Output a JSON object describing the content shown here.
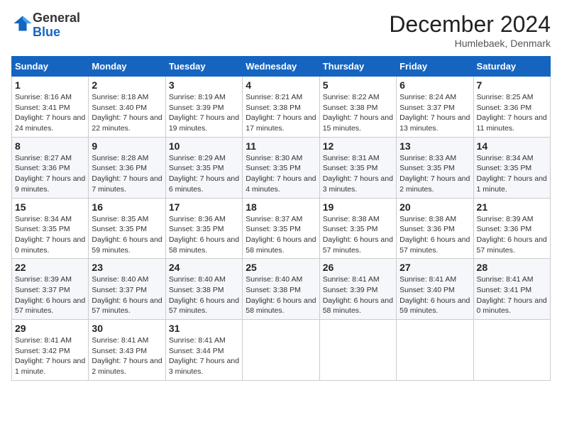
{
  "header": {
    "logo_general": "General",
    "logo_blue": "Blue",
    "month_title": "December 2024",
    "location": "Humlebaek, Denmark"
  },
  "days_of_week": [
    "Sunday",
    "Monday",
    "Tuesday",
    "Wednesday",
    "Thursday",
    "Friday",
    "Saturday"
  ],
  "weeks": [
    [
      {
        "day": "1",
        "sunrise": "Sunrise: 8:16 AM",
        "sunset": "Sunset: 3:41 PM",
        "daylight": "Daylight: 7 hours and 24 minutes."
      },
      {
        "day": "2",
        "sunrise": "Sunrise: 8:18 AM",
        "sunset": "Sunset: 3:40 PM",
        "daylight": "Daylight: 7 hours and 22 minutes."
      },
      {
        "day": "3",
        "sunrise": "Sunrise: 8:19 AM",
        "sunset": "Sunset: 3:39 PM",
        "daylight": "Daylight: 7 hours and 19 minutes."
      },
      {
        "day": "4",
        "sunrise": "Sunrise: 8:21 AM",
        "sunset": "Sunset: 3:38 PM",
        "daylight": "Daylight: 7 hours and 17 minutes."
      },
      {
        "day": "5",
        "sunrise": "Sunrise: 8:22 AM",
        "sunset": "Sunset: 3:38 PM",
        "daylight": "Daylight: 7 hours and 15 minutes."
      },
      {
        "day": "6",
        "sunrise": "Sunrise: 8:24 AM",
        "sunset": "Sunset: 3:37 PM",
        "daylight": "Daylight: 7 hours and 13 minutes."
      },
      {
        "day": "7",
        "sunrise": "Sunrise: 8:25 AM",
        "sunset": "Sunset: 3:36 PM",
        "daylight": "Daylight: 7 hours and 11 minutes."
      }
    ],
    [
      {
        "day": "8",
        "sunrise": "Sunrise: 8:27 AM",
        "sunset": "Sunset: 3:36 PM",
        "daylight": "Daylight: 7 hours and 9 minutes."
      },
      {
        "day": "9",
        "sunrise": "Sunrise: 8:28 AM",
        "sunset": "Sunset: 3:36 PM",
        "daylight": "Daylight: 7 hours and 7 minutes."
      },
      {
        "day": "10",
        "sunrise": "Sunrise: 8:29 AM",
        "sunset": "Sunset: 3:35 PM",
        "daylight": "Daylight: 7 hours and 6 minutes."
      },
      {
        "day": "11",
        "sunrise": "Sunrise: 8:30 AM",
        "sunset": "Sunset: 3:35 PM",
        "daylight": "Daylight: 7 hours and 4 minutes."
      },
      {
        "day": "12",
        "sunrise": "Sunrise: 8:31 AM",
        "sunset": "Sunset: 3:35 PM",
        "daylight": "Daylight: 7 hours and 3 minutes."
      },
      {
        "day": "13",
        "sunrise": "Sunrise: 8:33 AM",
        "sunset": "Sunset: 3:35 PM",
        "daylight": "Daylight: 7 hours and 2 minutes."
      },
      {
        "day": "14",
        "sunrise": "Sunrise: 8:34 AM",
        "sunset": "Sunset: 3:35 PM",
        "daylight": "Daylight: 7 hours and 1 minute."
      }
    ],
    [
      {
        "day": "15",
        "sunrise": "Sunrise: 8:34 AM",
        "sunset": "Sunset: 3:35 PM",
        "daylight": "Daylight: 7 hours and 0 minutes."
      },
      {
        "day": "16",
        "sunrise": "Sunrise: 8:35 AM",
        "sunset": "Sunset: 3:35 PM",
        "daylight": "Daylight: 6 hours and 59 minutes."
      },
      {
        "day": "17",
        "sunrise": "Sunrise: 8:36 AM",
        "sunset": "Sunset: 3:35 PM",
        "daylight": "Daylight: 6 hours and 58 minutes."
      },
      {
        "day": "18",
        "sunrise": "Sunrise: 8:37 AM",
        "sunset": "Sunset: 3:35 PM",
        "daylight": "Daylight: 6 hours and 58 minutes."
      },
      {
        "day": "19",
        "sunrise": "Sunrise: 8:38 AM",
        "sunset": "Sunset: 3:35 PM",
        "daylight": "Daylight: 6 hours and 57 minutes."
      },
      {
        "day": "20",
        "sunrise": "Sunrise: 8:38 AM",
        "sunset": "Sunset: 3:36 PM",
        "daylight": "Daylight: 6 hours and 57 minutes."
      },
      {
        "day": "21",
        "sunrise": "Sunrise: 8:39 AM",
        "sunset": "Sunset: 3:36 PM",
        "daylight": "Daylight: 6 hours and 57 minutes."
      }
    ],
    [
      {
        "day": "22",
        "sunrise": "Sunrise: 8:39 AM",
        "sunset": "Sunset: 3:37 PM",
        "daylight": "Daylight: 6 hours and 57 minutes."
      },
      {
        "day": "23",
        "sunrise": "Sunrise: 8:40 AM",
        "sunset": "Sunset: 3:37 PM",
        "daylight": "Daylight: 6 hours and 57 minutes."
      },
      {
        "day": "24",
        "sunrise": "Sunrise: 8:40 AM",
        "sunset": "Sunset: 3:38 PM",
        "daylight": "Daylight: 6 hours and 57 minutes."
      },
      {
        "day": "25",
        "sunrise": "Sunrise: 8:40 AM",
        "sunset": "Sunset: 3:38 PM",
        "daylight": "Daylight: 6 hours and 58 minutes."
      },
      {
        "day": "26",
        "sunrise": "Sunrise: 8:41 AM",
        "sunset": "Sunset: 3:39 PM",
        "daylight": "Daylight: 6 hours and 58 minutes."
      },
      {
        "day": "27",
        "sunrise": "Sunrise: 8:41 AM",
        "sunset": "Sunset: 3:40 PM",
        "daylight": "Daylight: 6 hours and 59 minutes."
      },
      {
        "day": "28",
        "sunrise": "Sunrise: 8:41 AM",
        "sunset": "Sunset: 3:41 PM",
        "daylight": "Daylight: 7 hours and 0 minutes."
      }
    ],
    [
      {
        "day": "29",
        "sunrise": "Sunrise: 8:41 AM",
        "sunset": "Sunset: 3:42 PM",
        "daylight": "Daylight: 7 hours and 1 minute."
      },
      {
        "day": "30",
        "sunrise": "Sunrise: 8:41 AM",
        "sunset": "Sunset: 3:43 PM",
        "daylight": "Daylight: 7 hours and 2 minutes."
      },
      {
        "day": "31",
        "sunrise": "Sunrise: 8:41 AM",
        "sunset": "Sunset: 3:44 PM",
        "daylight": "Daylight: 7 hours and 3 minutes."
      },
      null,
      null,
      null,
      null
    ]
  ]
}
